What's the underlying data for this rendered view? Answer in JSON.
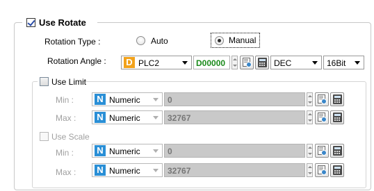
{
  "use_rotate": {
    "label": "Use Rotate",
    "checked": true
  },
  "rotation_type": {
    "label": "Rotation Type :",
    "options": [
      {
        "label": "Auto",
        "selected": false
      },
      {
        "label": "Manual",
        "selected": true
      }
    ]
  },
  "rotation_angle": {
    "label": "Rotation Angle :",
    "device_badge": "D",
    "device": "PLC2",
    "address": "D00000",
    "format": "DEC",
    "bit_size": "16Bit"
  },
  "use_limit": {
    "label": "Use Limit",
    "checked": false,
    "min": {
      "label": "Min :",
      "badge": "N",
      "type": "Numeric",
      "value": "0"
    },
    "max": {
      "label": "Max :",
      "badge": "N",
      "type": "Numeric",
      "value": "32767"
    }
  },
  "use_scale": {
    "label": "Use Scale",
    "checked": false,
    "min": {
      "label": "Min :",
      "badge": "N",
      "type": "Numeric",
      "value": "0"
    },
    "max": {
      "label": "Max :",
      "badge": "N",
      "type": "Numeric",
      "value": "32767"
    }
  },
  "colors": {
    "device_badge": "#f2a21b",
    "numeric_badge": "#2a8fd6",
    "address_text": "#1a8a1a",
    "disabled_field": "#c9c9c9"
  }
}
